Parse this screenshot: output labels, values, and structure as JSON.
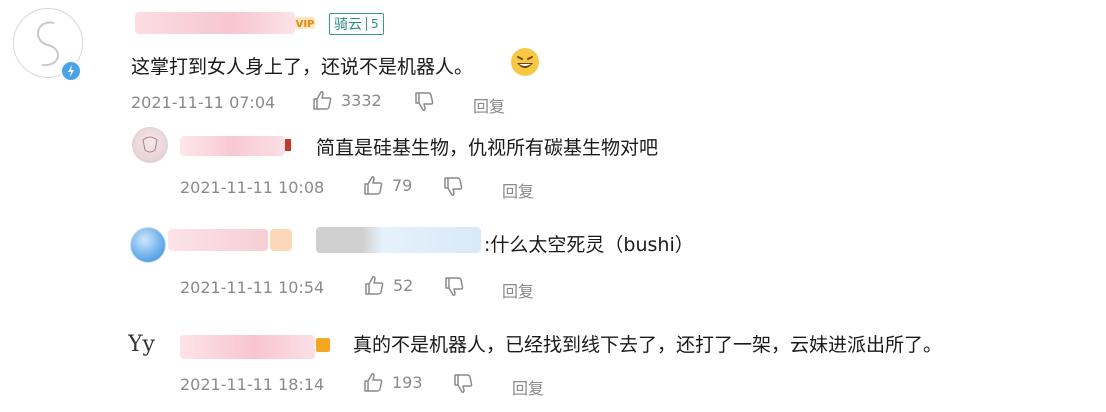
{
  "colors": {
    "name_blur": "#f7c6cf",
    "badge_border": "#3a9a8a",
    "badge_text": "#2d8c7e",
    "meta_text": "#8a8a8a",
    "vip_orange": "#f5a623",
    "verified_blue": "#4aa3e8"
  },
  "comments": [
    {
      "id": "c1",
      "badge_label": "骑云",
      "badge_level": "5",
      "text": "这掌打到女人身上了，还说不是机器人。",
      "emoji": "grinning-face-emoji",
      "time": "2021-11-11 07:04",
      "likes": "3332",
      "reply_label": "回复"
    },
    {
      "id": "c2",
      "text": "简直是硅基生物，仇视所有碳基生物对吧",
      "time": "2021-11-11 10:08",
      "likes": "79",
      "reply_label": "回复"
    },
    {
      "id": "c3",
      "text": ":什么太空死灵（bushi）",
      "time": "2021-11-11 10:54",
      "likes": "52",
      "reply_label": "回复"
    },
    {
      "id": "c4",
      "text": "真的不是机器人，已经找到线下去了，还打了一架，云妹进派出所了。",
      "avatar_text": "Yy",
      "time": "2021-11-11 18:14",
      "likes": "193",
      "reply_label": "回复"
    }
  ]
}
